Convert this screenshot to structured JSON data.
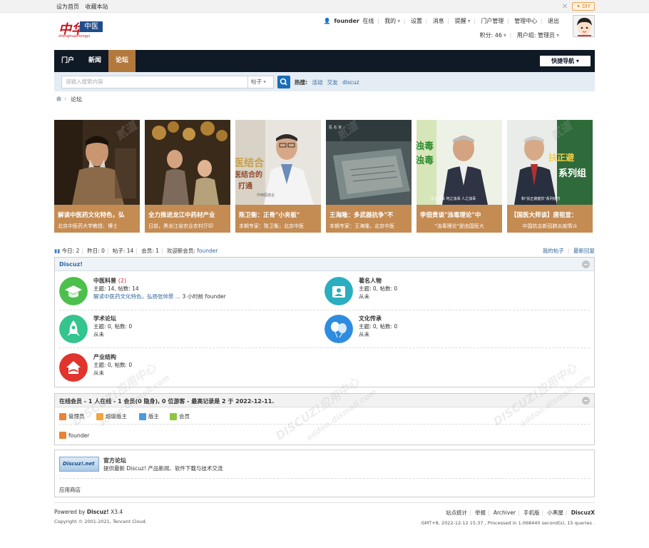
{
  "topbar": {
    "set_home": "设为首页",
    "bookmark": "收藏本站",
    "diy": "DIY"
  },
  "logo": {
    "zh": "中华",
    "box": "中医",
    "pinyin": "zhonghuazhongyi"
  },
  "user": {
    "name": "founder",
    "status": "在线",
    "links": [
      "我的",
      "设置",
      "消息",
      "提醒",
      "门户管理",
      "管理中心",
      "退出"
    ],
    "points_label": "积分: 46",
    "group_label": "用户组: 管理员"
  },
  "nav": {
    "items": [
      "门户",
      "新闻",
      "论坛"
    ],
    "active": "论坛",
    "quick": "快捷导航"
  },
  "search": {
    "placeholder": "请输入搜索内容",
    "type": "帖子",
    "hot_label": "热搜:",
    "hot": [
      "活动",
      "交友",
      "discuz"
    ]
  },
  "breadcrumb": {
    "current": "论坛"
  },
  "slides": [
    {
      "title": "解读中医药文化特色，弘",
      "sub": "北京中医药大学教授、博士"
    },
    {
      "title": "全力推进龙江中药材产业",
      "sub": "日前，黑龙江省农业农村厅印"
    },
    {
      "title": "陈卫衡：正骨\"小夹板\"",
      "sub": "本期专家：陈卫衡，北京中医"
    },
    {
      "title": "王海隆：多武器抗争\"不",
      "sub": "本期专家：王海隆，北京中医"
    },
    {
      "title": "李佃贵谈\"浊毒理论\"中",
      "sub": "\"浊毒理论\"是由国医大"
    },
    {
      "title": "【国医大师谈】唐祖宣：",
      "sub": "中国抗击新冠肺炎疫情斗"
    }
  ],
  "slide_overlays": {
    "s3": "医结合",
    "s3b": "医结合的",
    "s3c": "打通",
    "s3d": "中西医结合",
    "s4": "医 名 家",
    "s5a": "浊毒",
    "s5b": "浊毒",
    "s5c": "天之浊毒  地之浊毒  人之浊毒",
    "s6a": "扶正避",
    "s6b": "系列组",
    "s6c": "和\"扶正避瘟饮\"系列组方"
  },
  "stats": {
    "today": "今日: 2",
    "yesterday": "昨日: 0",
    "posts": "帖子: 14",
    "members": "会员: 1",
    "welcome": "欢迎新会员:",
    "new_member": "founder",
    "my_posts": "我的帖子",
    "latest": "最新回复"
  },
  "category": {
    "title": "Discuz!",
    "forums": [
      {
        "name": "中医科普",
        "count": "(2)",
        "stats": "主题: 14, 帖数: 14",
        "last_link": "解读中医药文化特色，弘扬张仲景 ...",
        "last_rest": "3 小时前 founder",
        "color": "#4cbf4c"
      },
      {
        "name": "著名人物",
        "count": "",
        "stats": "主题: 0, 帖数: 0",
        "last_link": "",
        "last_rest": "从未",
        "color": "#2aaec0"
      },
      {
        "name": "学术论坛",
        "count": "",
        "stats": "主题: 0, 帖数: 0",
        "last_link": "",
        "last_rest": "从未",
        "color": "#34c48e"
      },
      {
        "name": "文化传承",
        "count": "",
        "stats": "主题: 0, 帖数: 0",
        "last_link": "",
        "last_rest": "从未",
        "color": "#2d8ce0"
      },
      {
        "name": "产业结构",
        "count": "",
        "stats": "主题: 0, 帖数: 0",
        "last_link": "",
        "last_rest": "从未",
        "color": "#e0342c"
      }
    ]
  },
  "online": {
    "title": "在线会员 - 1 人在线 - 1 会员(0 隐身), 0 位游客 - 最高记录是 2 于 2022-12-11.",
    "legend": [
      {
        "label": "管理员",
        "color": "#e8833a"
      },
      {
        "label": "超级版主",
        "color": "#f0a63c"
      },
      {
        "label": "版主",
        "color": "#4a9be0"
      },
      {
        "label": "会员",
        "color": "#8cc63f"
      }
    ],
    "member": "founder"
  },
  "links": {
    "logo_text": "Discuz!.net",
    "title": "官方论坛",
    "desc": "提供最新 Discuz! 产品新闻、软件下载与技术交流",
    "app_store": "应用商店"
  },
  "footer": {
    "powered_pre": "Powered by",
    "powered_name": "Discuz!",
    "version": "X3.4",
    "copyright": "Copyright © 2001-2021, Tencent Cloud.",
    "links": [
      "站点统计",
      "举报",
      "Archiver",
      "手机版",
      "小黑屋"
    ],
    "brand": "DiscuzX",
    "time": "GMT+8, 2022-12-12 15:37 , Processed in 1.068440 second(s), 15 queries ."
  },
  "watermark": {
    "text1": "DISCUZ!应用中心",
    "text2": "addon.dismall.com",
    "text3": "贰道",
    "mark": "®"
  }
}
